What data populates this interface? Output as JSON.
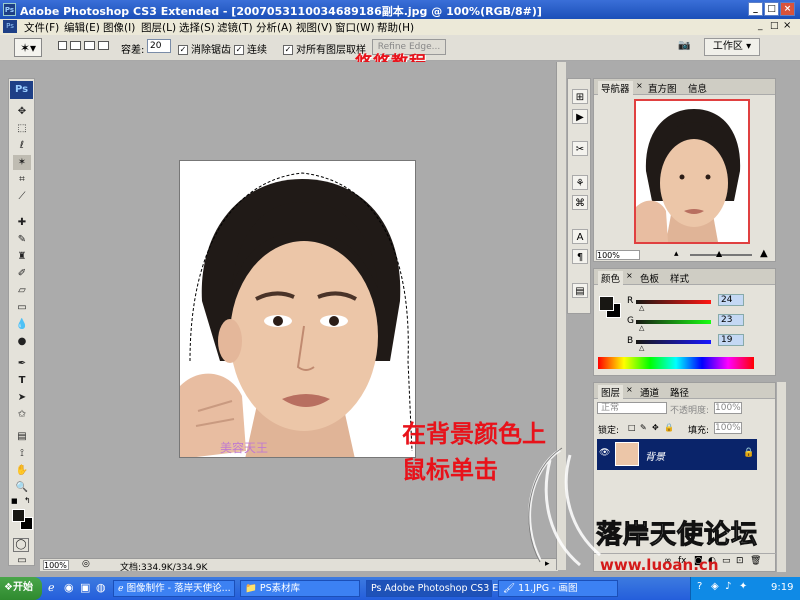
{
  "window": {
    "title": "Adobe Photoshop CS3 Extended - [20070531100346891​86副本.jpg @ 100%(RGB/8#)]"
  },
  "menu": [
    "文件(F)",
    "编辑(E)",
    "图像(I)",
    "图层(L)",
    "选择(S)",
    "滤镜(T)",
    "分析(A)",
    "视图(V)",
    "窗口(W)",
    "帮助(H)"
  ],
  "options": {
    "tolerance_label": "容差:",
    "tolerance_value": "20",
    "antialias": "消除锯齿",
    "contiguous": "连续",
    "all_layers": "对所有图层取样",
    "refine": "Refine Edge...",
    "workspace": "工作区 ▾"
  },
  "overlay": {
    "top": "悠悠教程",
    "instruction1": "在背景颜色上",
    "instruction2": "鼠标单击",
    "watermark_text": "美容天王",
    "watermark_url": "www.luoan.cn",
    "logo_text": "落岸天使论坛"
  },
  "status": {
    "zoom": "100%",
    "doc": "文档:334.9K/334.9K"
  },
  "navigator": {
    "tabs": [
      "导航器",
      "直方图",
      "信息"
    ],
    "zoom": "100%"
  },
  "color_panel": {
    "tabs": [
      "颜色",
      "色板",
      "样式"
    ],
    "r_label": "R",
    "r_value": "24",
    "g_label": "G",
    "g_value": "23",
    "b_label": "B",
    "b_value": "19"
  },
  "layers_panel": {
    "tabs": [
      "图层",
      "通道",
      "路径"
    ],
    "blend": "正常",
    "opacity_label": "不透明度:",
    "opacity_value": "100%",
    "lock_label": "锁定:",
    "fill_label": "填充:",
    "fill_value": "100%",
    "layer_name": "背景"
  },
  "taskbar": {
    "start": "开始",
    "items": [
      "图像制作 - 落岸天使论...",
      "PS素材库",
      "Adobe Photoshop CS3 E...",
      "11.JPG - 画图"
    ],
    "clock": "9:19"
  },
  "colors": {
    "layer_selected": "#0a246a",
    "title": "#1b4fb8",
    "accent_red": "#e8121a"
  }
}
